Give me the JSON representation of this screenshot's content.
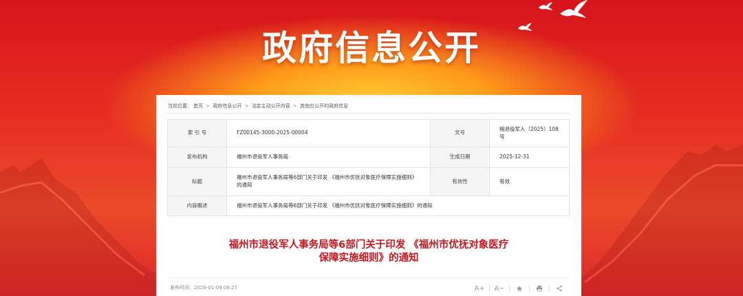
{
  "banner": {
    "title": "政府信息公开"
  },
  "breadcrumb": {
    "prefix": "当前位置：",
    "items": [
      "首页",
      "政府信息公开",
      "法定主动公开内容",
      "其他应公开的政府信息"
    ],
    "separator": ">"
  },
  "meta": {
    "index_label": "索 引 号",
    "index_value": "FZ00145-3000-2025-00004",
    "doc_no_label": "文号",
    "doc_no_value": "榕退役军人〔2025〕108号",
    "publisher_label": "发布机构",
    "publisher_value": "福州市退役军人事务局",
    "created_label": "生成日期",
    "created_value": "2025-12-31",
    "title_label": "标题",
    "title_value": "福州市退役军人事务局等6部门关于印发 《福州市优抚对象医疗保障实施细则》的通知",
    "validity_label": "有效性",
    "validity_value": "有效",
    "summary_label": "内容概述",
    "summary_value": "福州市退役军人事务局等6部门关于印发 《福州市优抚对象医疗保障实施细则》的通知"
  },
  "document": {
    "title_line1": "福州市退役军人事务局等6部门关于印发 《福州市优抚对象医疗",
    "title_line2": "保障实施细则》的通知",
    "publish_date": "发布时间：2026-01-04 09:27"
  },
  "tools": {
    "font_increase": "A+",
    "font_decrease": "A−",
    "favorite_icon": "star-icon",
    "print_icon": "print-icon",
    "share_icon": "share-icon"
  },
  "colors": {
    "accent": "#c8161d",
    "banner_red": "#d6141b",
    "banner_glow": "#ffcf33"
  }
}
